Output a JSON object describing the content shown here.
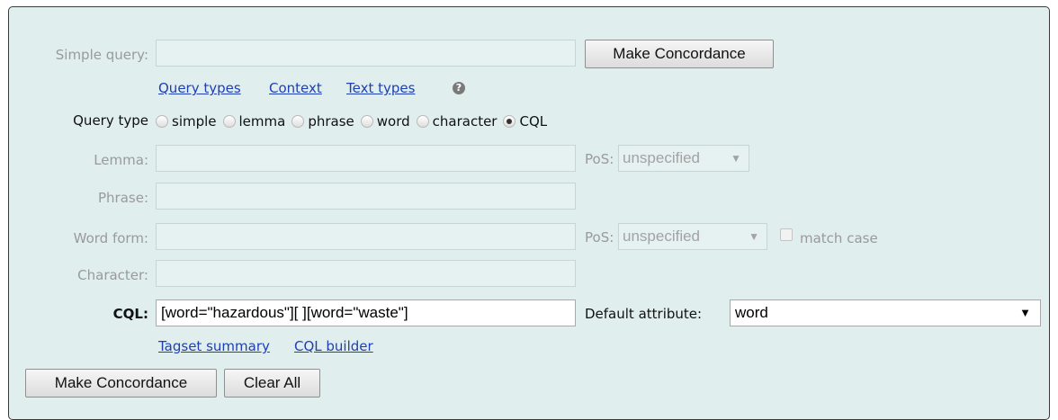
{
  "form": {
    "simple_query": {
      "label": "Simple query:",
      "value": ""
    },
    "make_concordance_top": "Make Concordance",
    "links_top": {
      "query_types": "Query types",
      "context": "Context",
      "text_types": "Text types",
      "help_icon": "?"
    },
    "query_type": {
      "label": "Query type",
      "options": [
        "simple",
        "lemma",
        "phrase",
        "word",
        "character",
        "CQL"
      ],
      "selected": "CQL"
    },
    "lemma": {
      "label": "Lemma:",
      "pos_label": "PoS:",
      "pos_value": "unspecified"
    },
    "phrase": {
      "label": "Phrase:"
    },
    "word_form": {
      "label": "Word form:",
      "pos_label": "PoS:",
      "pos_value": "unspecified",
      "match_case": "match case"
    },
    "character": {
      "label": "Character:"
    },
    "cql": {
      "label": "CQL:",
      "value": "[word=\"hazardous\"][ ][word=\"waste\"]",
      "default_attr_label": "Default attribute:",
      "default_attr_value": "word"
    },
    "links_bottom": {
      "tagset_summary": "Tagset summary",
      "cql_builder": "CQL builder"
    },
    "buttons": {
      "make_concordance": "Make Concordance",
      "clear_all": "Clear All"
    }
  },
  "colors": {
    "panel_bg": "#e0eeee",
    "link": "#1f3fb5",
    "disabled_text": "#9a9a9a"
  }
}
